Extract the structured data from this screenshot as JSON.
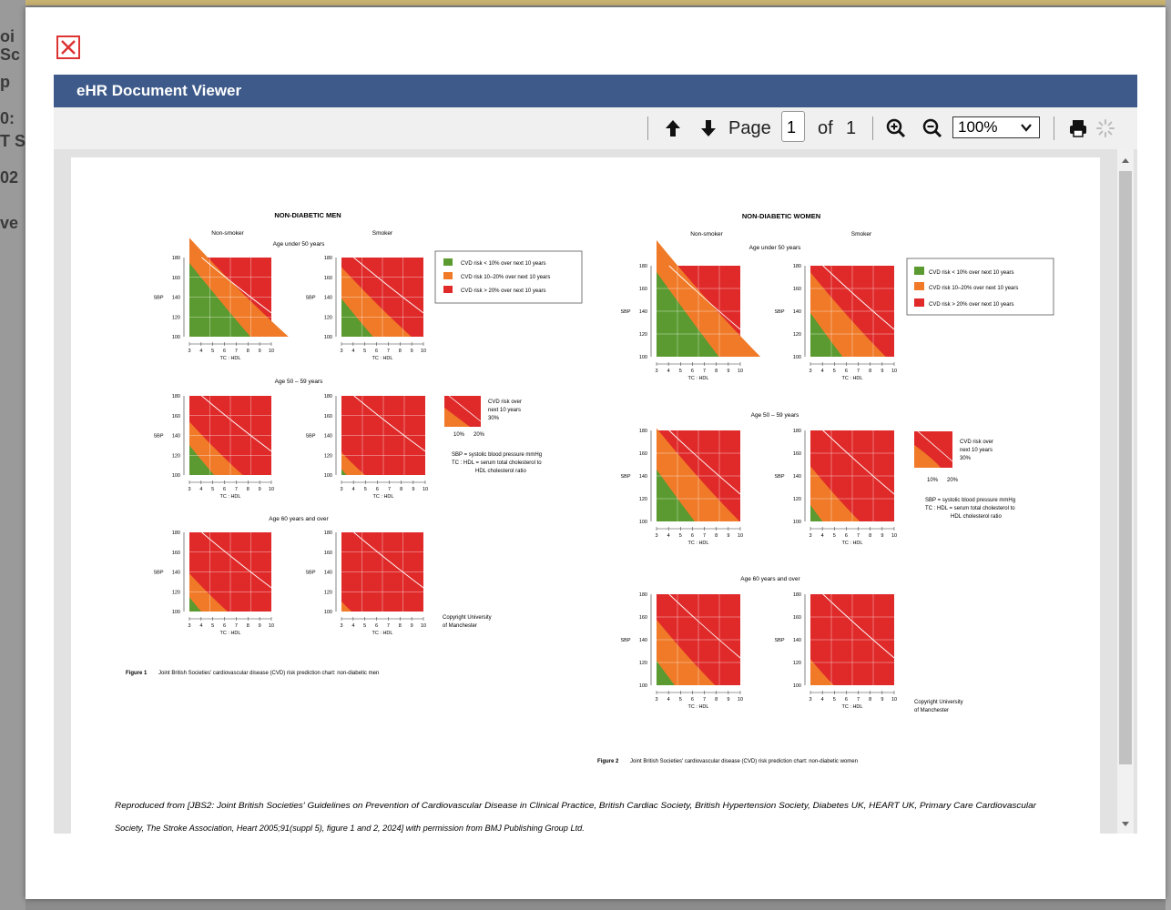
{
  "viewer": {
    "title": "eHR Document Viewer",
    "page_label": "Page",
    "current_page": "1",
    "of_label": "of",
    "total_pages": "1",
    "zoom": "100%"
  },
  "background": {
    "left_fragments": [
      "oi",
      "Sc",
      "p",
      "0:",
      "T S",
      "02",
      "ve"
    ]
  },
  "document": {
    "men_title": "NON-DIABETIC MEN",
    "women_title": "NON-DIABETIC WOMEN",
    "non_smoker": "Non-smoker",
    "smoker": "Smoker",
    "age_under_50": "Age under 50 years",
    "age_50_59": "Age 50 – 59 years",
    "age_60_over": "Age 60 years and over",
    "sbp": "SBP",
    "tc_hdl": "TC : HDL",
    "y_ticks": [
      "180",
      "160",
      "140",
      "120",
      "100"
    ],
    "x_ticks": [
      "3",
      "4",
      "5",
      "6",
      "7",
      "8",
      "9",
      "10"
    ],
    "legend": [
      {
        "color": "#5a9a30",
        "label": "CVD risk < 10% over next 10 years"
      },
      {
        "color": "#f07a28",
        "label": "CVD risk 10–20% over next 10 years"
      },
      {
        "color": "#e02a2a",
        "label": "CVD risk > 20% over next 10 years"
      }
    ],
    "risk_note": [
      "CVD risk over",
      "next 10 years",
      "30%"
    ],
    "risk_pcts": [
      "10%",
      "20%"
    ],
    "sbp_note_1": "SBP = systolic blood pressure mmHg",
    "sbp_note_2": "TC : HDL = serum total cholesterol to",
    "sbp_note_3": "HDL cholesterol ratio",
    "copyright_1": "Copyright University",
    "copyright_2": "of Manchester",
    "figure1_caption": "Joint British Societies' cardiovascular disease (CVD) risk prediction chart: non-diabetic men",
    "figure1_label": "Figure 1",
    "figure2_caption": "Joint British Societies' cardiovascular disease (CVD) risk prediction chart: non-diabetic women",
    "figure2_label": "Figure 2",
    "reproduced_1": "Reproduced from [JBS2: Joint British Societies' Guidelines on Prevention of Cardiovascular Disease in Clinical Practice, British Cardiac Society, British Hypertension Society, Diabetes UK, HEART UK, Primary Care Cardiovascular",
    "reproduced_2": "Society, The Stroke Association, Heart 2005;91(suppl 5), figure 1 and 2, 2024] with permission from BMJ Publishing Group Ltd."
  },
  "colors": {
    "header": "#3d5a8a",
    "green": "#5a9a30",
    "orange": "#f07a28",
    "red": "#e02a2a"
  }
}
